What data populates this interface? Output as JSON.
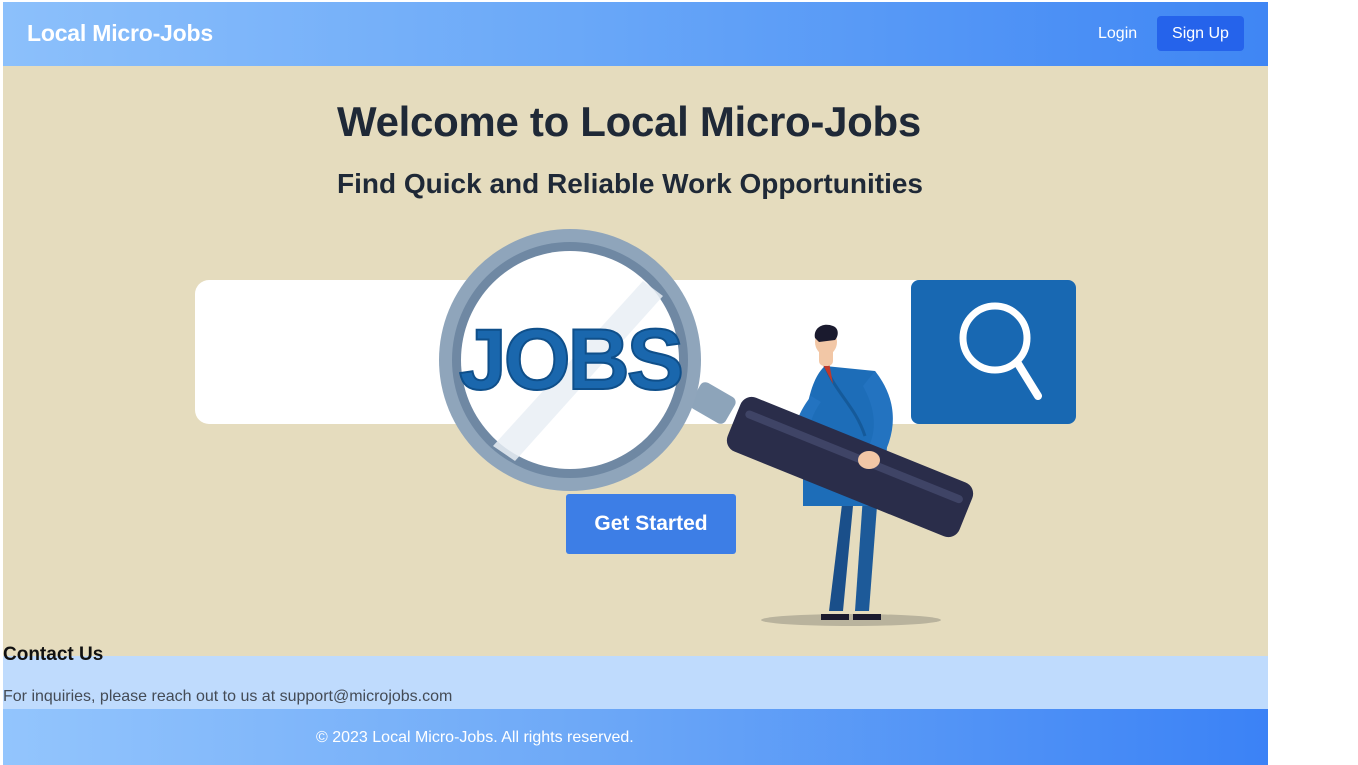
{
  "header": {
    "brand": "Local Micro-Jobs",
    "login_label": "Login",
    "signup_label": "Sign Up"
  },
  "hero": {
    "title": "Welcome to Local Micro-Jobs",
    "subtitle": "Find Quick and Reliable Work Opportunities",
    "illustration_text": "JOBS",
    "cta_label": "Get Started"
  },
  "contact": {
    "title": "Contact Us",
    "text": "For inquiries, please reach out to us at support@microjobs.com"
  },
  "footer": {
    "copyright": "© 2023 Local Micro-Jobs. All rights reserved."
  },
  "colors": {
    "header_gradient_start": "#8cc0fb",
    "header_gradient_end": "#3f86f4",
    "signup_button": "#2563eb",
    "hero_background": "#e5dcbe",
    "cta_button": "#3d7ee6",
    "contact_background": "#bfdbfd",
    "illustration_blue": "#1868b2"
  },
  "icons": [
    "magnifying-glass-icon",
    "search-icon"
  ]
}
